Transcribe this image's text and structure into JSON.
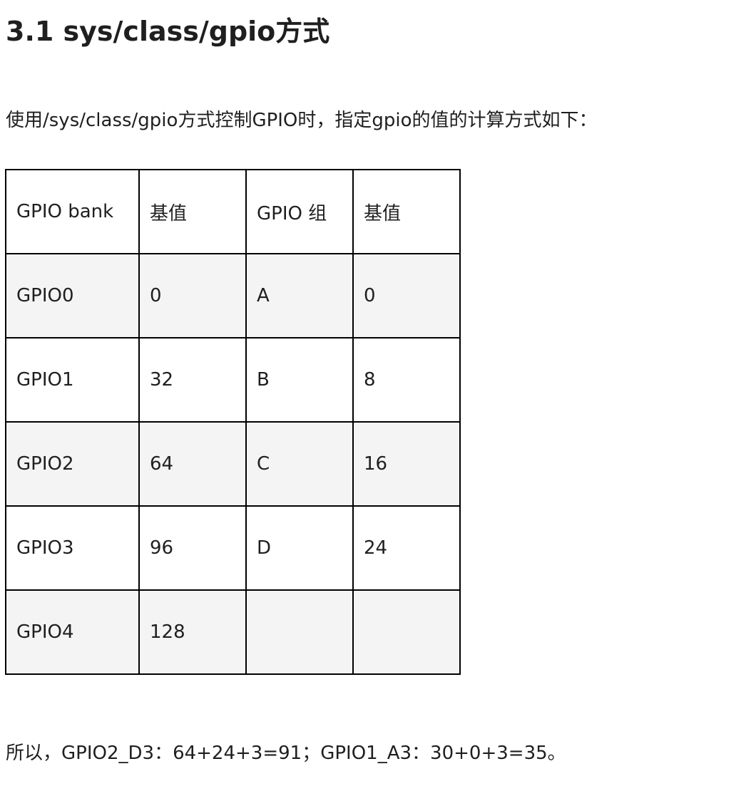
{
  "document": {
    "title": "3.1 sys/class/gpio方式",
    "intro": "使用/sys/class/gpio方式控制GPIO时，指定gpio的值的计算方式如下：",
    "table": {
      "headers": [
        "GPIO bank",
        "基值",
        "GPIO 组",
        "基值"
      ],
      "rows": [
        [
          "GPIO0",
          "0",
          "A",
          "0"
        ],
        [
          "GPIO1",
          "32",
          "B",
          "8"
        ],
        [
          "GPIO2",
          "64",
          "C",
          "16"
        ],
        [
          "GPIO3",
          "96",
          "D",
          "24"
        ],
        [
          "GPIO4",
          "128",
          "",
          ""
        ]
      ]
    },
    "summary": "所以，GPIO2_D3：64+24+3=91；GPIO1_A3：30+0+3=35。"
  }
}
